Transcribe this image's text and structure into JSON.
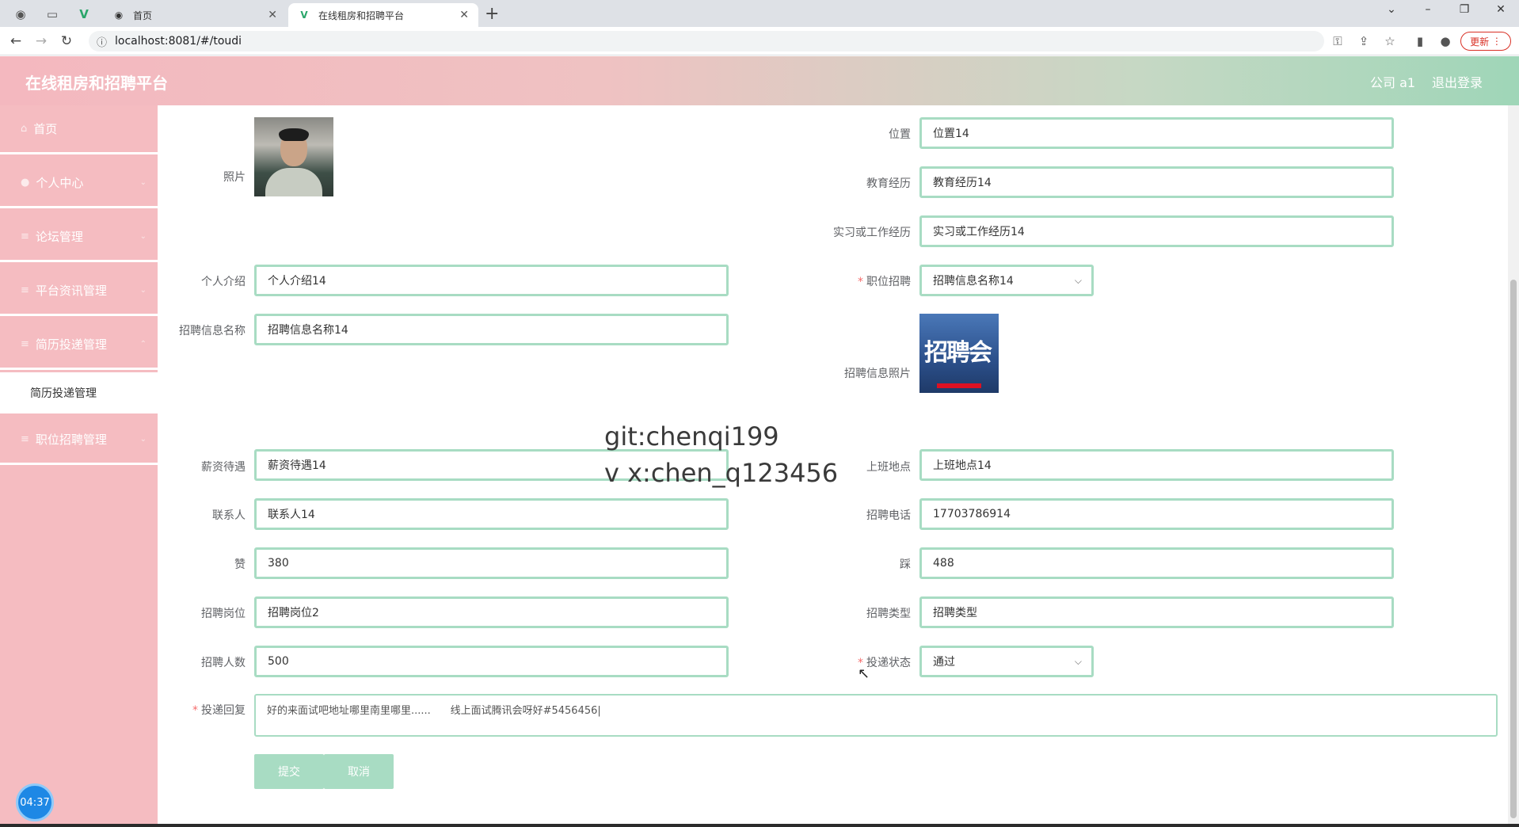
{
  "browser": {
    "tabs": [
      {
        "label": "首页"
      },
      {
        "label": "在线租房和招聘平台"
      }
    ],
    "url": "localhost:8081/#/toudi",
    "update_label": "更新"
  },
  "header": {
    "title": "在线租房和招聘平台",
    "user": "公司 a1",
    "logout": "退出登录"
  },
  "sidebar": {
    "items": [
      {
        "label": "首页"
      },
      {
        "label": "个人中心"
      },
      {
        "label": "论坛管理"
      },
      {
        "label": "平台资讯管理"
      },
      {
        "label": "简历投递管理"
      },
      {
        "label": "职位招聘管理"
      }
    ],
    "submenu_label": "简历投递管理",
    "clock": "04:37"
  },
  "form": {
    "photo_label": "照片",
    "location_label": "位置",
    "location_value": "位置14",
    "education_label": "教育经历",
    "education_value": "教育经历14",
    "work_label": "实习或工作经历",
    "work_value": "实习或工作经历14",
    "intro_label": "个人介绍",
    "intro_value": "个人介绍14",
    "job_label": "职位招聘",
    "job_value": "招聘信息名称14",
    "info_name_label": "招聘信息名称",
    "info_name_value": "招聘信息名称14",
    "info_photo_label": "招聘信息照片",
    "info_photo_text": "招聘会",
    "salary_label": "薪资待遇",
    "salary_value": "薪资待遇14",
    "workplace_label": "上班地点",
    "workplace_value": "上班地点14",
    "contact_label": "联系人",
    "contact_value": "联系人14",
    "phone_label": "招聘电话",
    "phone_value": "17703786914",
    "like_label": "赞",
    "like_value": "380",
    "dislike_label": "踩",
    "dislike_value": "488",
    "position_label": "招聘岗位",
    "position_value": "招聘岗位2",
    "type_label": "招聘类型",
    "type_value": "招聘类型",
    "count_label": "招聘人数",
    "count_value": "500",
    "status_label": "投递状态",
    "status_value": "通过",
    "reply_label": "投递回复",
    "reply_value": "好的来面试吧地址哪里南里哪里......      线上面试腾讯会呀好#5456456|",
    "submit_label": "提交",
    "cancel_label": "取消"
  },
  "watermark": {
    "line1": "git:chenqi199",
    "line2": "v x:chen_q123456"
  }
}
